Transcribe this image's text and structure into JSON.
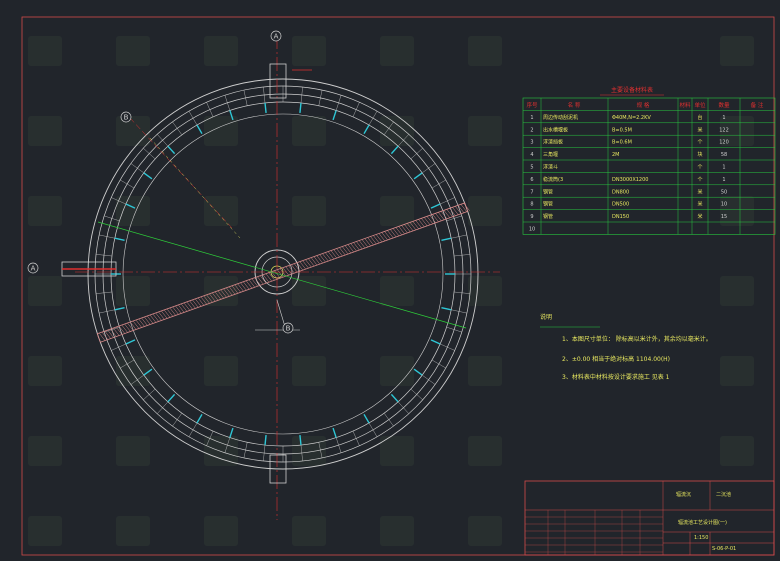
{
  "drawing": {
    "section_mark_a": "A",
    "section_mark_b": "B",
    "colors": {
      "background": "#21252b",
      "frame": "#d24a4a",
      "tank_ring": "#cfcfcf",
      "cyan_marks": "#2ec7d6",
      "center_line_red": "#e03030",
      "green_line": "#2ecf3a",
      "pink_duct": "#d88a8a",
      "table_green": "#28c840",
      "text_yellow": "#e8e860"
    }
  },
  "materials_table": {
    "title": "主要设备材料表",
    "headers": [
      "序号",
      "名    称",
      "规          格",
      "材料",
      "单位",
      "数量",
      "备    注"
    ],
    "rows": [
      {
        "no": "1",
        "name": "周边传动刮泥机",
        "spec": "Φ40M,N=2.2KV",
        "unit": "台",
        "qty": "1"
      },
      {
        "no": "2",
        "name": "出水槽堰板",
        "spec": "B=0.5M",
        "unit": "米",
        "qty": "122"
      },
      {
        "no": "3",
        "name": "浮渣挡板",
        "spec": "B=0.6M",
        "unit": "个",
        "qty": "120"
      },
      {
        "no": "4",
        "name": "三角堰",
        "spec": "2M",
        "unit": "块",
        "qty": "58"
      },
      {
        "no": "5",
        "name": "浮渣斗",
        "spec": "",
        "unit": "个",
        "qty": "1"
      },
      {
        "no": "6",
        "name": "稳流筒(3",
        "spec": "DN3000X1200",
        "unit": "个",
        "qty": "1"
      },
      {
        "no": "7",
        "name": "钢管",
        "spec": "DN800",
        "unit": "米",
        "qty": "50"
      },
      {
        "no": "8",
        "name": "钢管",
        "spec": "DN500",
        "unit": "米",
        "qty": "10"
      },
      {
        "no": "9",
        "name": "钢管",
        "spec": "DN150",
        "unit": "米",
        "qty": "15"
      },
      {
        "no": "10",
        "name": "",
        "spec": "",
        "unit": "",
        "qty": ""
      }
    ]
  },
  "notes": {
    "heading": "说明",
    "items": [
      "1、本图尺寸单位：    除标高以米计外，其余均以毫米计。",
      "2、±0.00 相当于绝对标高        1104.00(H)",
      "3、材料表中材料按设计要求施工    见表 1"
    ]
  },
  "title_block": {
    "project": "辐流沉",
    "stage": "二沉池",
    "drawing_title": "辐流池工艺设计图(一)",
    "scale": "1:150",
    "drawing_no": "S-06-P-01"
  }
}
